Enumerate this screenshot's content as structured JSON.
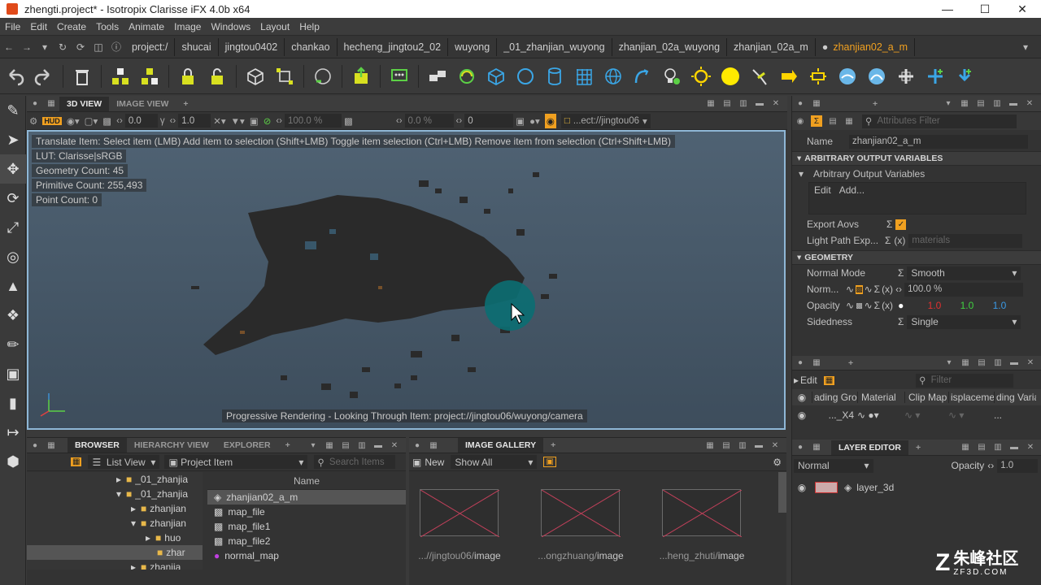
{
  "window": {
    "title": "zhengti.project* - Isotropix Clarisse iFX 4.0b x64"
  },
  "menu": [
    "File",
    "Edit",
    "Create",
    "Tools",
    "Animate",
    "Image",
    "Windows",
    "Layout",
    "Help"
  ],
  "breadcrumbs": [
    "project:/",
    "shucai",
    "jingtou0402",
    "chankao",
    "hecheng_jingtou2_02",
    "wuyong",
    "_01_zhanjian_wuyong",
    "zhanjian_02a_wuyong",
    "zhanjian_02a_m",
    "zhanjian02_a_m"
  ],
  "viewport": {
    "tabs": [
      "3D VIEW",
      "IMAGE VIEW"
    ],
    "toolbar": {
      "hud": "HUD",
      "v1": "0.0",
      "v2": "1.0",
      "v3": "100.0 %",
      "v4": "0.0 %",
      "v5": "0",
      "path": "...ect://jingtou06"
    },
    "hud_lines": [
      "Translate Item: Select item (LMB)  Add item to selection (Shift+LMB)  Toggle item selection (Ctrl+LMB)  Remove item from selection (Ctrl+Shift+LMB)",
      "LUT: Clarisse|sRGB",
      "Geometry Count: 45",
      "Primitive Count: 255,493",
      "Point Count: 0"
    ],
    "status": "Progressive Rendering - Looking Through Item: project://jingtou06/wuyong/camera"
  },
  "attributes": {
    "filter_placeholder": "Attributes Filter",
    "name_label": "Name",
    "name_value": "zhanjian02_a_m",
    "sect_aov": "ARBITRARY OUTPUT VARIABLES",
    "aov_group": "Arbitrary Output Variables",
    "edit": "Edit",
    "add": "Add...",
    "export_aovs": "Export Aovs",
    "light_path": "Light Path Exp...",
    "materials": "materials",
    "sect_geo": "GEOMETRY",
    "normal_mode_label": "Normal Mode",
    "normal_mode_value": "Smooth",
    "norm_label": "Norm...",
    "norm_value": "100.0 %",
    "opacity_label": "Opacity",
    "opacity_r": "1.0",
    "opacity_g": "1.0",
    "opacity_b": "1.0",
    "sidedness_label": "Sidedness",
    "sidedness_value": "Single"
  },
  "shading": {
    "edit": "Edit",
    "filter_placeholder": "Filter",
    "cols": [
      "ading Grou",
      "Material",
      "Clip Map",
      "isplaceme",
      "ding Varia"
    ],
    "row_val": "..._X4"
  },
  "layer_editor": {
    "title": "LAYER EDITOR",
    "blend": "Normal",
    "opacity_label": "Opacity",
    "opacity_value": "1.0",
    "layer": "layer_3d"
  },
  "browser": {
    "tabs": [
      "BROWSER",
      "HIERARCHY VIEW",
      "EXPLORER"
    ],
    "list_view": "List View",
    "project_item": "Project Item",
    "search_placeholder": "Search Items",
    "tree": [
      "_01_zhanjia",
      "_01_zhanjia",
      "zhanjian",
      "zhanjian",
      "huo",
      "zhar",
      "zhanjia"
    ],
    "col_name": "Name",
    "items": [
      "zhanjian02_a_m",
      "map_file",
      "map_file1",
      "map_file2",
      "normal_map"
    ]
  },
  "gallery": {
    "title": "IMAGE GALLERY",
    "new": "New",
    "show": "Show All",
    "images": [
      {
        "prefix": "...//jingtou06/",
        "name": "image"
      },
      {
        "prefix": "...ongzhuang/",
        "name": "image"
      },
      {
        "prefix": "...heng_zhuti/",
        "name": "image"
      }
    ]
  },
  "watermark": {
    "text": "朱峰社区",
    "sub": "ZF3D.COM"
  }
}
